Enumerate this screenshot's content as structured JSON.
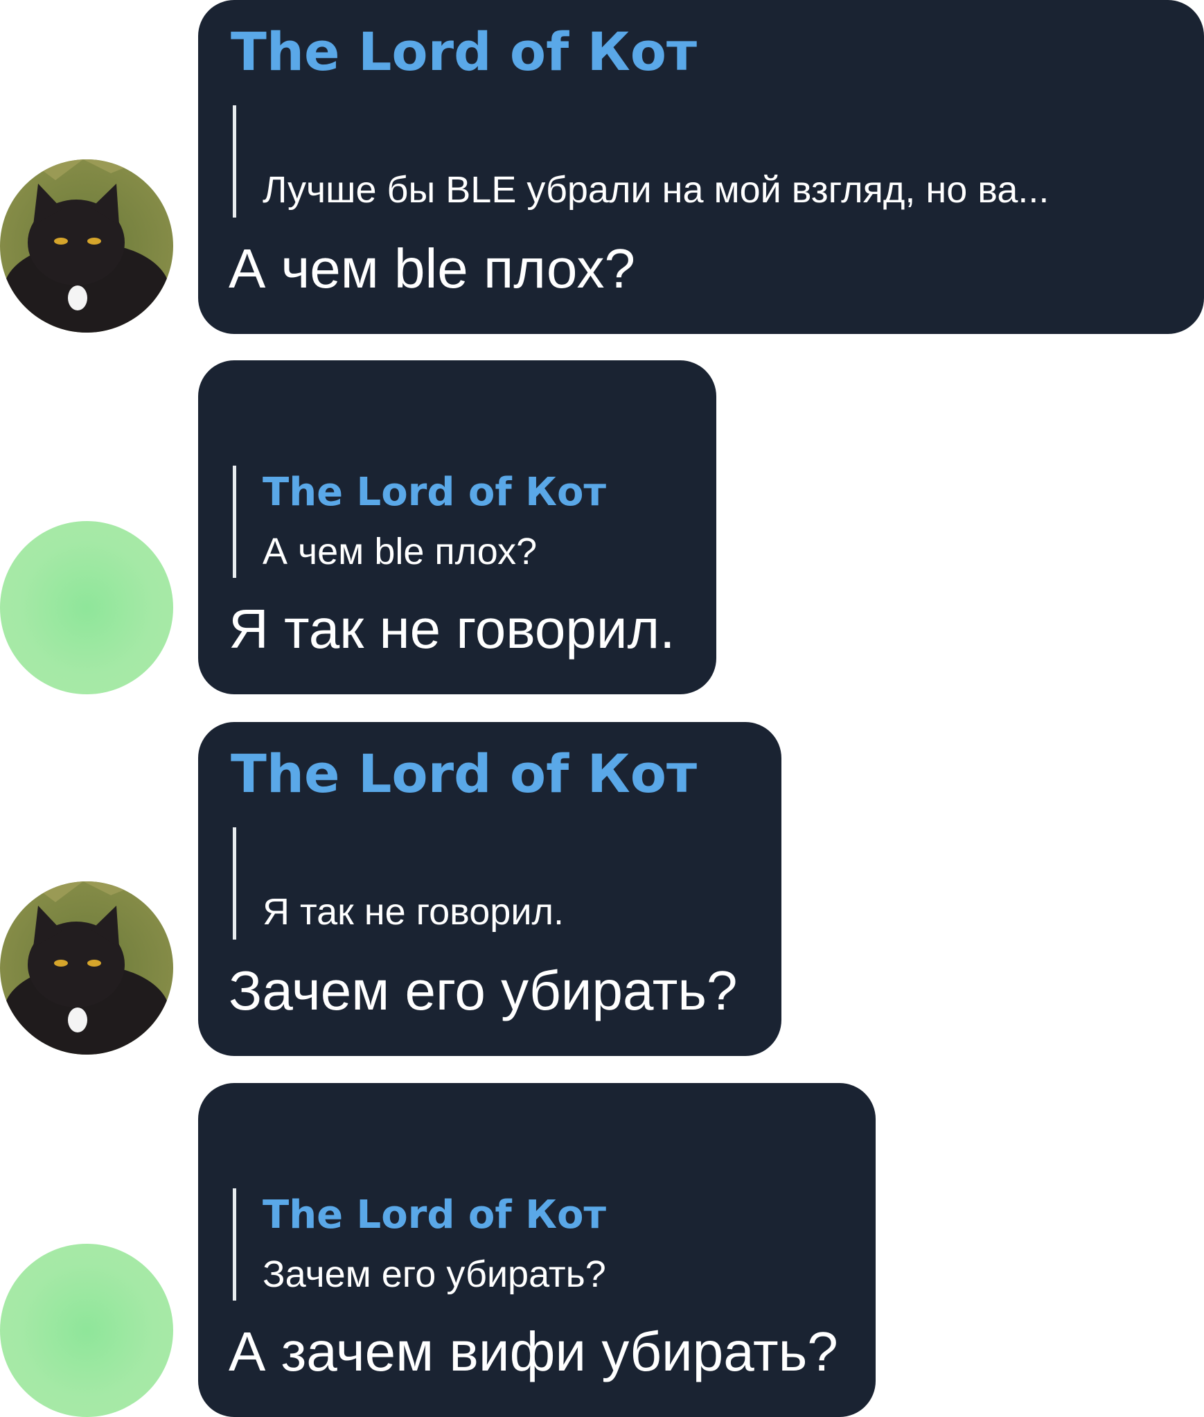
{
  "colors": {
    "bubble_bg": "#1a2332",
    "sender_name": "#5aa8e8",
    "message_text": "#ffffff",
    "quote_bar": "#e8ecef",
    "green_avatar": "#a5e9a6"
  },
  "messages": [
    {
      "avatar": "cat-photo",
      "sender": "The Lord of Кот",
      "quote": {
        "name": "",
        "text": "Лучше бы BLE убрали на мой взгляд, но ва..."
      },
      "text": "А чем ble плох?"
    },
    {
      "avatar": "green-circle",
      "sender": "",
      "quote": {
        "name": "The Lord of Кот",
        "text": "А чем ble плох?"
      },
      "text": "Я так не говорил."
    },
    {
      "avatar": "cat-photo",
      "sender": "The Lord of Кот",
      "quote": {
        "name": "",
        "text": "Я так не говорил."
      },
      "text": "Зачем его убирать?"
    },
    {
      "avatar": "green-circle",
      "sender": "",
      "quote": {
        "name": "The Lord of Кот",
        "text": "Зачем его убирать?"
      },
      "text": "А зачем вифи убирать?"
    }
  ]
}
